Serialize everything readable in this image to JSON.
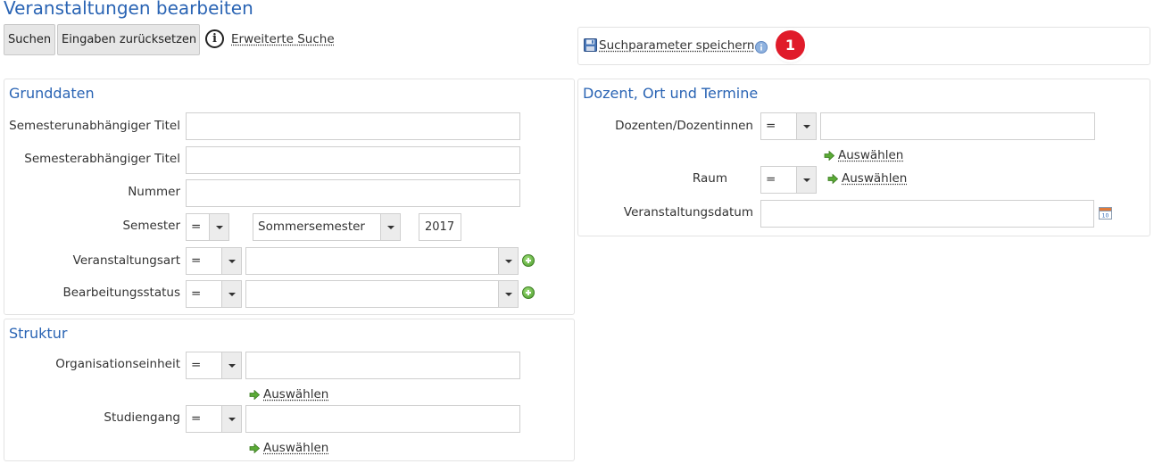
{
  "page": {
    "title": "Veranstaltungen bearbeiten"
  },
  "toolbar": {
    "search_label": "Suchen",
    "reset_label": "Eingaben zurücksetzen",
    "info_symbol": "i",
    "advanced_search_label": "Erweiterte Suche"
  },
  "save_box": {
    "save_params_label": "Suchparameter speichern",
    "badge": "1"
  },
  "grunddaten": {
    "title": "Grunddaten",
    "fields": {
      "sem_indep_title": {
        "label": "Semesterunabhängiger Titel",
        "value": ""
      },
      "sem_dep_title": {
        "label": "Semesterabhängiger Titel",
        "value": ""
      },
      "number": {
        "label": "Nummer",
        "value": ""
      },
      "semester": {
        "label": "Semester",
        "operator": "=",
        "term": "Sommersemester",
        "year": "2017"
      },
      "event_type": {
        "label": "Veranstaltungsart",
        "operator": "=",
        "value": ""
      },
      "status": {
        "label": "Bearbeitungsstatus",
        "operator": "=",
        "value": ""
      }
    }
  },
  "struktur": {
    "title": "Struktur",
    "fields": {
      "org_unit": {
        "label": "Organisationseinheit",
        "operator": "=",
        "value": "",
        "select_label": "Auswählen"
      },
      "study_program": {
        "label": "Studiengang",
        "operator": "=",
        "value": "",
        "select_label": "Auswählen"
      }
    }
  },
  "dozent": {
    "title": "Dozent, Ort und Termine",
    "fields": {
      "lecturers": {
        "label": "Dozenten/Dozentinnen",
        "operator": "=",
        "value": "",
        "select_label": "Auswählen"
      },
      "room": {
        "label": "Raum",
        "operator": "=",
        "select_label": "Auswählen"
      },
      "event_date": {
        "label": "Veranstaltungsdatum",
        "value": "",
        "calendar_day": "10"
      }
    }
  },
  "colors": {
    "accent": "#2a64b4",
    "badge": "#e01b2a",
    "panel_border": "#e3e3e3",
    "plus_green": "#4a9a2a"
  }
}
